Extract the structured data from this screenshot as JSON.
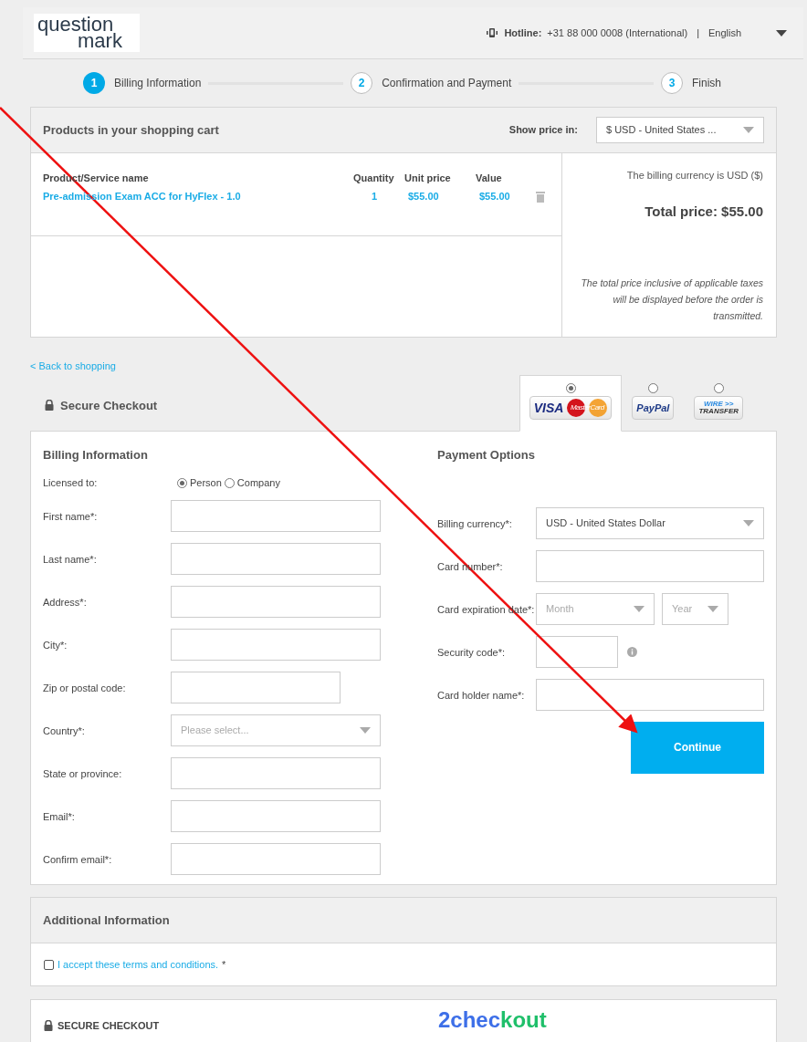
{
  "header": {
    "logo": [
      "question",
      "mark"
    ],
    "hotline_label": "Hotline:",
    "hotline_number": "+31 88 000 0008 (International)",
    "separator": "|",
    "language": "English"
  },
  "steps": [
    {
      "number": "1",
      "label": "Billing Information",
      "selected": true
    },
    {
      "number": "2",
      "label": "Confirmation and Payment",
      "selected": false
    },
    {
      "number": "3",
      "label": "Finish",
      "selected": false
    }
  ],
  "cart": {
    "title": "Products in your shopping cart",
    "show_price_label": "Show price in:",
    "currency_select": "$ USD - United States ...",
    "columns": [
      "Product/Service name",
      "Quantity",
      "Unit price",
      "Value"
    ],
    "rows": [
      {
        "name": "Pre-admission Exam ACC for HyFlex - 1.0",
        "quantity": "1",
        "unit_price": "$55.00",
        "value": "$55.00"
      }
    ],
    "billing_currency_note": "The billing currency is USD ($)",
    "total": "Total price: $55.00",
    "tax_note": "The total price inclusive of applicable taxes will be displayed before the order is transmitted."
  },
  "back_link": "< Back to shopping",
  "checkout": {
    "title": "Secure Checkout",
    "payment_methods": [
      {
        "kind": "card",
        "labels": [
          "VISA",
          "MasterCard"
        ],
        "selected": true
      },
      {
        "kind": "paypal",
        "labels": [
          "PayPal"
        ],
        "selected": false
      },
      {
        "kind": "wire",
        "labels": [
          "WIRE >>",
          "TRANSFER"
        ],
        "selected": false
      }
    ],
    "billing": {
      "title": "Billing Information",
      "licensed_label": "Licensed to:",
      "license_options": [
        {
          "label": "Person",
          "selected": true
        },
        {
          "label": "Company",
          "selected": false
        }
      ],
      "fields": [
        {
          "label": "First name*:",
          "kind": "input"
        },
        {
          "label": "Last name*:",
          "kind": "input"
        },
        {
          "label": "Address*:",
          "kind": "input"
        },
        {
          "label": "City*:",
          "kind": "input"
        },
        {
          "label": "Zip or postal code:",
          "kind": "short"
        },
        {
          "label": "Country*:",
          "kind": "select",
          "placeholder": "Please select..."
        },
        {
          "label": "State or province:",
          "kind": "input"
        },
        {
          "label": "Email*:",
          "kind": "input"
        },
        {
          "label": "Confirm email*:",
          "kind": "input"
        }
      ]
    },
    "payment": {
      "title": "Payment Options",
      "fields": [
        {
          "label": "Billing currency*:",
          "kind": "select",
          "value": "USD - United States Dollar"
        },
        {
          "label": "Card number*:",
          "kind": "input"
        },
        {
          "label": "Card expiration date*:",
          "kind": "expiry",
          "month": "Month",
          "year": "Year"
        },
        {
          "label": "Security code*:",
          "kind": "security"
        },
        {
          "label": "Card holder name*:",
          "kind": "input"
        }
      ],
      "continue": "Continue"
    }
  },
  "additional": {
    "title": "Additional Information",
    "terms": "I accept these terms and conditions.",
    "required_mark": "*",
    "checked": false
  },
  "footer": {
    "secure": "SECURE CHECKOUT",
    "brand": [
      {
        "text": "2chec",
        "color": "#3d6fe8"
      },
      {
        "text": "kout",
        "color": "#1fbf6a"
      }
    ]
  }
}
